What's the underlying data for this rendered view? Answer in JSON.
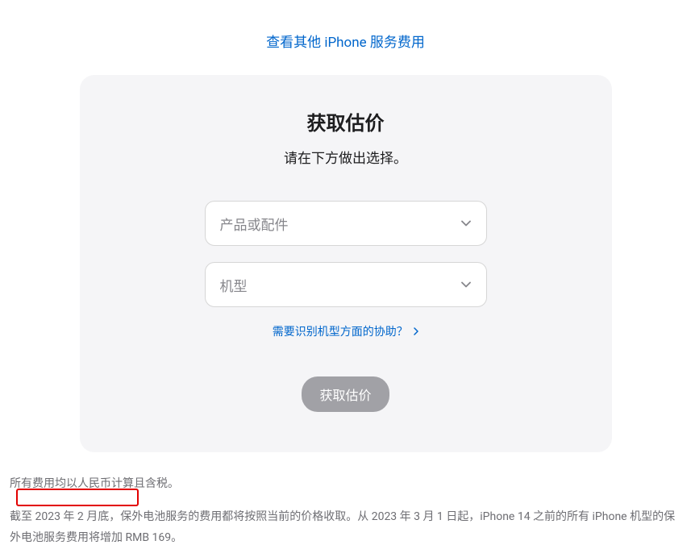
{
  "topLink": {
    "text": "查看其他 iPhone 服务费用"
  },
  "card": {
    "title": "获取估价",
    "subtitle": "请在下方做出选择。",
    "productSelect": {
      "placeholder": "产品或配件"
    },
    "modelSelect": {
      "placeholder": "机型"
    },
    "helpLink": {
      "text": "需要识别机型方面的协助？"
    },
    "submitButton": {
      "label": "获取估价"
    }
  },
  "footer": {
    "line1": "所有费用均以人民币计算且含税。",
    "line2": "截至 2023 年 2 月底，保外电池服务的费用都将按照当前的价格收取。从 2023 年 3 月 1 日起，iPhone 14 之前的所有 iPhone 机型的保外电池服务费用将增加 RMB 169。"
  }
}
